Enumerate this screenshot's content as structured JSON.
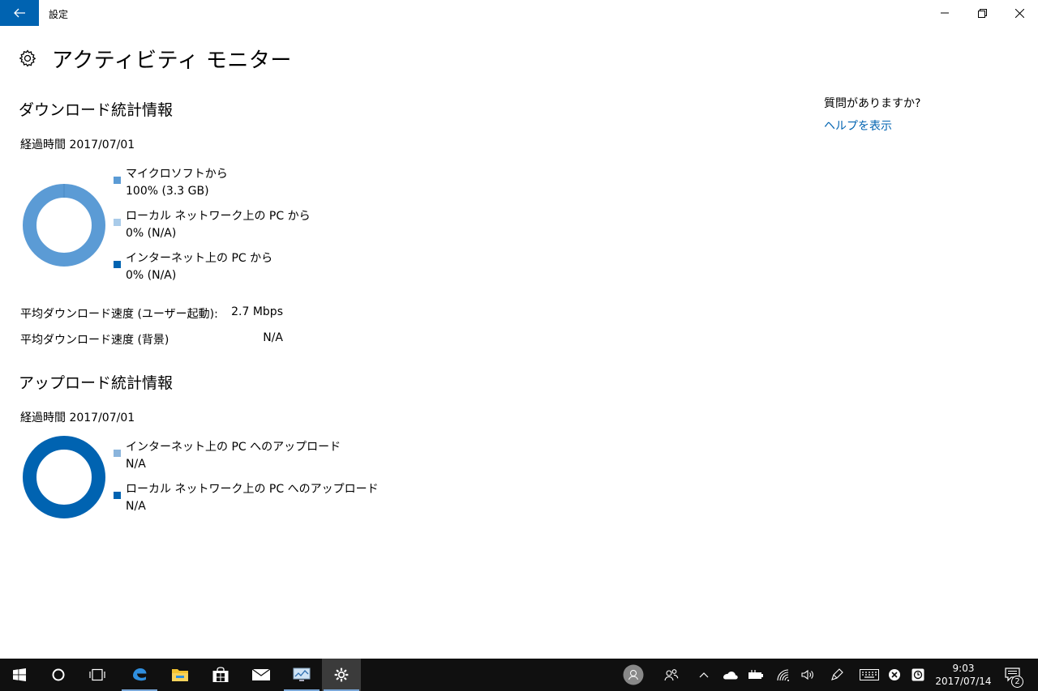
{
  "window": {
    "title": "設定",
    "back_icon": "back-arrow-icon"
  },
  "page": {
    "title": "アクティビティ モニター"
  },
  "download": {
    "title": "ダウンロード統計情報",
    "elapsed": "経過時間 2017/07/01",
    "legend": [
      {
        "label": "マイクロソフトから",
        "value": "100% (3.3 GB)",
        "color": "#5b9bd5",
        "fraction": 1.0
      },
      {
        "label": "ローカル ネットワーク上の PC から",
        "value": "0% (N/A)",
        "color": "#a9cbe9",
        "fraction": 0.0
      },
      {
        "label": "インターネット上の PC から",
        "value": "0% (N/A)",
        "color": "#0063b1",
        "fraction": 0.0
      }
    ],
    "speeds": [
      {
        "label": "平均ダウンロード速度 (ユーザー起動):",
        "value": "2.7 Mbps"
      },
      {
        "label": "平均ダウンロード速度 (背景)",
        "value": "N/A"
      }
    ]
  },
  "upload": {
    "title": "アップロード統計情報",
    "elapsed": "経過時間 2017/07/01",
    "legend": [
      {
        "label": "インターネット上の PC へのアップロード",
        "value": "N/A",
        "color": "#8ab4dc"
      },
      {
        "label": "ローカル ネットワーク上の PC へのアップロード",
        "value": "N/A",
        "color": "#0063b1"
      }
    ],
    "ring_color": "#0063b1"
  },
  "help": {
    "question": "質問がありますか?",
    "link": "ヘルプを表示"
  },
  "taskbar": {
    "time": "9:03",
    "date": "2017/07/14",
    "notification_count": "2"
  },
  "colors": {
    "accent": "#0063b1",
    "taskbar": "#101010"
  }
}
